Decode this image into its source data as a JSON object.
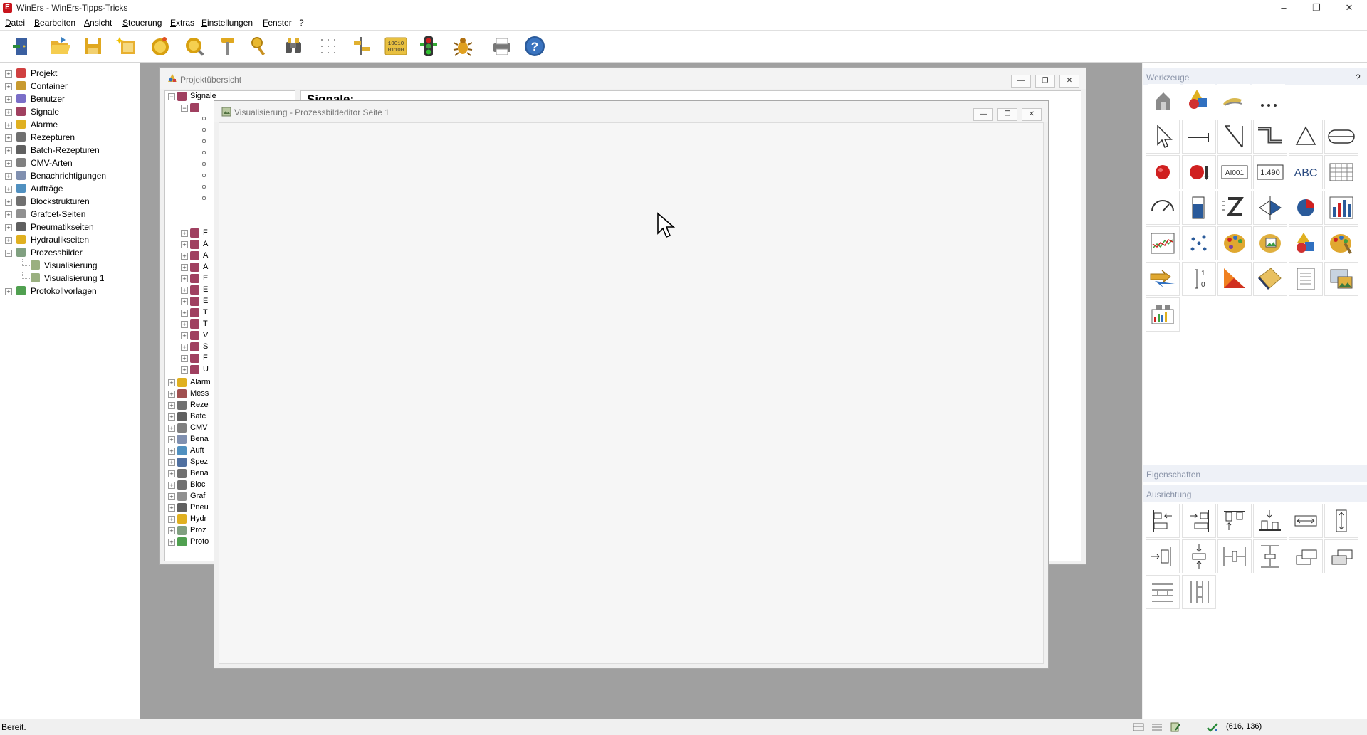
{
  "window": {
    "title": "WinErs - WinErs-Tipps-Tricks",
    "app_icon_letter": "E"
  },
  "menu": [
    "Datei",
    "Bearbeiten",
    "Ansicht",
    "Steuerung",
    "Extras",
    "Einstellungen",
    "Fenster",
    "?"
  ],
  "toolbar": {
    "icons": [
      "exit-icon",
      "open-folder-icon",
      "save-icon",
      "new-project-icon",
      "compile-icon",
      "search-icon",
      "tool-icon",
      "magnifier-icon",
      "binoculars-icon",
      "grid-icon",
      "alignment-icon",
      "binary-icon",
      "traffic-light-icon",
      "debug-bug-icon",
      "printer-icon",
      "help-icon"
    ],
    "binary_text": "10010\n01100"
  },
  "left_tree": {
    "items": [
      {
        "label": "Projekt",
        "expander": "+",
        "icon": "project-icon",
        "color": "#d04040"
      },
      {
        "label": "Container",
        "expander": "+",
        "icon": "container-icon",
        "color": "#c89a30"
      },
      {
        "label": "Benutzer",
        "expander": "+",
        "icon": "user-icon",
        "color": "#7a6ec8"
      },
      {
        "label": "Signale",
        "expander": "+",
        "icon": "signal-icon",
        "color": "#a04060"
      },
      {
        "label": "Alarme",
        "expander": "+",
        "icon": "alarm-icon",
        "color": "#e0b020"
      },
      {
        "label": "Rezepturen",
        "expander": "+",
        "icon": "recipe-icon",
        "color": "#707070"
      },
      {
        "label": "Batch-Rezepturen",
        "expander": "+",
        "icon": "batch-icon",
        "color": "#606060"
      },
      {
        "label": "CMV-Arten",
        "expander": "+",
        "icon": "cmv-icon",
        "color": "#808080"
      },
      {
        "label": "Benachrichtigungen",
        "expander": "+",
        "icon": "notification-icon",
        "color": "#8090b0"
      },
      {
        "label": "Aufträge",
        "expander": "+",
        "icon": "order-icon",
        "color": "#5090c0"
      },
      {
        "label": "Blockstrukturen",
        "expander": "+",
        "icon": "block-icon",
        "color": "#707070"
      },
      {
        "label": "Grafcet-Seiten",
        "expander": "+",
        "icon": "grafcet-icon",
        "color": "#909090"
      },
      {
        "label": "Pneumatikseiten",
        "expander": "+",
        "icon": "pneumatic-icon",
        "color": "#606060"
      },
      {
        "label": "Hydraulikseiten",
        "expander": "+",
        "icon": "hydraulic-icon",
        "color": "#e0b020"
      },
      {
        "label": "Prozessbilder",
        "expander": "−",
        "icon": "process-image-icon",
        "color": "#80a080"
      },
      {
        "label": "Visualisierung",
        "expander": "",
        "icon": "visualization-icon",
        "color": "#9ab080",
        "sub": true
      },
      {
        "label": "Visualisierung 1",
        "expander": "",
        "icon": "visualization-icon",
        "color": "#9ab080",
        "sub": true
      },
      {
        "label": "Protokollvorlagen",
        "expander": "+",
        "icon": "protocol-icon",
        "color": "#50a050"
      }
    ]
  },
  "proj_window": {
    "title": "Projektübersicht",
    "heading": "Signale:",
    "tree": {
      "root": "Signale",
      "bottom_items": [
        "Alarm",
        "Mess",
        "Reze",
        "Batc",
        "CMV",
        "Bena",
        "Auft",
        "Spez",
        "Bena",
        "Bloc",
        "Graf",
        "Pneu",
        "Hydr",
        "Proz",
        "Proto"
      ],
      "signal_rows_letters": [
        "F",
        "A",
        "A",
        "A",
        "E",
        "E",
        "E",
        "T",
        "T",
        "V",
        "S",
        "F",
        "U"
      ]
    }
  },
  "vis_window": {
    "title": "Visualisierung - Prozessbildeditor Seite 1"
  },
  "right_pane": {
    "werkzeuge_label": "Werkzeuge",
    "help": "?",
    "eigenschaften_label": "Eigenschaften",
    "ausrichtung_label": "Ausrichtung",
    "tool_texts": {
      "ai": "AI001",
      "num": "1.490",
      "abc": "ABC"
    }
  },
  "statusbar": {
    "text": "Bereit.",
    "coords": "(616, 136)"
  }
}
